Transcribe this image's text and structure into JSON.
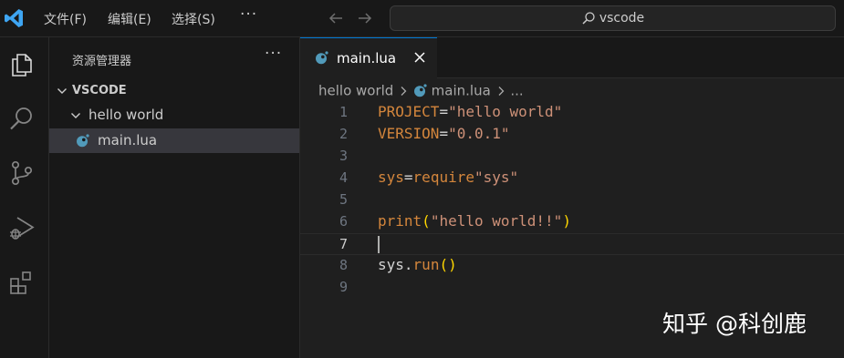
{
  "titlebar": {
    "logo_icon": "vscode-logo-icon",
    "menu": [
      "文件(F)",
      "编辑(E)",
      "选择(S)"
    ],
    "more": "···",
    "back_icon": "arrow-left-icon",
    "forward_icon": "arrow-right-icon",
    "search_text": "vscode",
    "search_icon": "search-icon"
  },
  "activitybar": {
    "items": [
      "explorer-icon",
      "search-icon",
      "source-control-icon",
      "run-debug-icon",
      "extensions-icon"
    ]
  },
  "sidebar": {
    "title": "资源管理器",
    "more": "···",
    "root": "VSCODE",
    "folder": "hello world",
    "file": "main.lua"
  },
  "tab": {
    "label": "main.lua",
    "close_icon": "close-icon"
  },
  "breadcrumb": {
    "folder": "hello world",
    "file": "main.lua",
    "more": "..."
  },
  "editor": {
    "active_line": 7,
    "lines": [
      {
        "n": "1",
        "tokens": [
          {
            "t": "PROJECT",
            "c": "#d4863c"
          },
          {
            "t": "=",
            "c": "#d4d4d4"
          },
          {
            "t": "\"hello world\"",
            "c": "#ce9178"
          }
        ]
      },
      {
        "n": "2",
        "tokens": [
          {
            "t": "VERSION",
            "c": "#d4863c"
          },
          {
            "t": "=",
            "c": "#d4d4d4"
          },
          {
            "t": "\"0.0.1\"",
            "c": "#ce9178"
          }
        ]
      },
      {
        "n": "3",
        "tokens": []
      },
      {
        "n": "4",
        "tokens": [
          {
            "t": "sys",
            "c": "#d4863c"
          },
          {
            "t": "=",
            "c": "#d4d4d4"
          },
          {
            "t": "require",
            "c": "#d4863c"
          },
          {
            "t": "\"sys\"",
            "c": "#ce9178"
          }
        ]
      },
      {
        "n": "5",
        "tokens": []
      },
      {
        "n": "6",
        "tokens": [
          {
            "t": "print",
            "c": "#d4863c"
          },
          {
            "t": "(",
            "c": "#ffd700"
          },
          {
            "t": "\"hello world!!\"",
            "c": "#ce9178"
          },
          {
            "t": ")",
            "c": "#ffd700"
          }
        ]
      },
      {
        "n": "7",
        "tokens": []
      },
      {
        "n": "8",
        "tokens": [
          {
            "t": "sys",
            "c": "#d4d4d4"
          },
          {
            "t": ".",
            "c": "#d4d4d4"
          },
          {
            "t": "run",
            "c": "#d4863c"
          },
          {
            "t": "()",
            "c": "#ffd700"
          }
        ]
      },
      {
        "n": "9",
        "tokens": []
      }
    ]
  },
  "watermark": "知乎 @科创鹿",
  "colors": {
    "accent": "#0078d4",
    "lua_icon": "#519aba"
  }
}
